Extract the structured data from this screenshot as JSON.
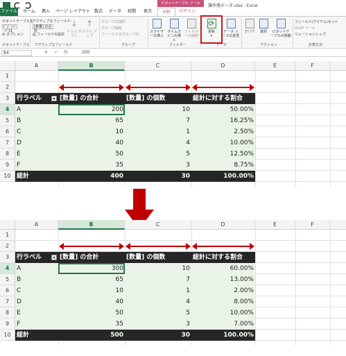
{
  "window": {
    "title": "操作用データ.xlsx - Excel",
    "context_header": "ピボットテーブル ツール"
  },
  "tabs": [
    "ファイル",
    "ホーム",
    "挿入",
    "ページ レイアウト",
    "数式",
    "データ",
    "校閲",
    "表示",
    "分析",
    "デザイン"
  ],
  "ribbon": {
    "pivot_name_label": "ピボットテーブル名:",
    "pivot_name_value": "ﾋﾟﾎﾞｯﾄﾃｰﾌﾞﾙ1",
    "options_label": "オプション",
    "active_field_label": "アクティブなフィールド:",
    "active_field_value": "[数量] の合計",
    "field_settings_label": "フィールドの設定",
    "drilldown_label": "ドリル ダウン",
    "drillup_label": "ドリル アップ",
    "group_selection_label": "グループの選択",
    "ungroup_label": "グループ解除",
    "group_field_label": "フィールドのグループ化",
    "slicer_label": "スライサーの挿入",
    "timeline_label": "タイムラインの挿入",
    "filter_conn_label": "フィルターの接続",
    "refresh_label": "更新",
    "datasource_label": "データ ソースの変更",
    "clear_label": "クリア",
    "select_label": "選択",
    "move_label": "ピボットテーブルの移動",
    "fields_items_label": "フィールド/アイテム/セット",
    "olap_label": "OLAP ツール",
    "relationships_label": "リレーションシップ",
    "groups": {
      "pivot": "ピボットテーブル",
      "active_field": "アクティブなフィールド",
      "group": "グループ",
      "filter": "フィルター",
      "data": "データ",
      "actions": "アクション",
      "calculations": "計算方法"
    }
  },
  "formula_bar": {
    "name_box": "B4",
    "cancel": "✕",
    "enter": "✓",
    "fx": "fx",
    "value": "200"
  },
  "columns": [
    "A",
    "B",
    "C",
    "D",
    "E",
    "F"
  ],
  "rows": [
    "1",
    "2",
    "3",
    "4",
    "5",
    "6",
    "7",
    "8",
    "9",
    "10"
  ],
  "pivot_headers": {
    "row_label": "行ラベル",
    "sum": "[数量] の合計",
    "count": "[数量] の個数",
    "pct": "総計に対する割合"
  },
  "before": {
    "data": [
      {
        "label": "A",
        "sum": "200",
        "count": "10",
        "pct": "50.00%"
      },
      {
        "label": "B",
        "sum": "65",
        "count": "7",
        "pct": "16.25%"
      },
      {
        "label": "C",
        "sum": "10",
        "count": "1",
        "pct": "2.50%"
      },
      {
        "label": "D",
        "sum": "40",
        "count": "4",
        "pct": "10.00%"
      },
      {
        "label": "E",
        "sum": "50",
        "count": "5",
        "pct": "12.50%"
      },
      {
        "label": "F",
        "sum": "35",
        "count": "3",
        "pct": "8.75%"
      }
    ],
    "total": {
      "label": "総計",
      "sum": "400",
      "count": "30",
      "pct": "100.00%"
    }
  },
  "after": {
    "data": [
      {
        "label": "A",
        "sum": "300",
        "count": "10",
        "pct": "60.00%"
      },
      {
        "label": "B",
        "sum": "65",
        "count": "7",
        "pct": "13.00%"
      },
      {
        "label": "C",
        "sum": "10",
        "count": "1",
        "pct": "2.00%"
      },
      {
        "label": "D",
        "sum": "40",
        "count": "4",
        "pct": "8.00%"
      },
      {
        "label": "E",
        "sum": "50",
        "count": "5",
        "pct": "10.00%"
      },
      {
        "label": "F",
        "sum": "35",
        "count": "3",
        "pct": "7.00%"
      }
    ],
    "total": {
      "label": "総計",
      "sum": "500",
      "count": "30",
      "pct": "100.00%"
    }
  },
  "colors": {
    "excel_green": "#217346",
    "context_pink": "#c9507a",
    "highlight_red": "#d0121b",
    "arrow_red": "#c00000",
    "pivot_header_bg": "#262626",
    "pivot_body_bg": "#eaf3e7"
  }
}
